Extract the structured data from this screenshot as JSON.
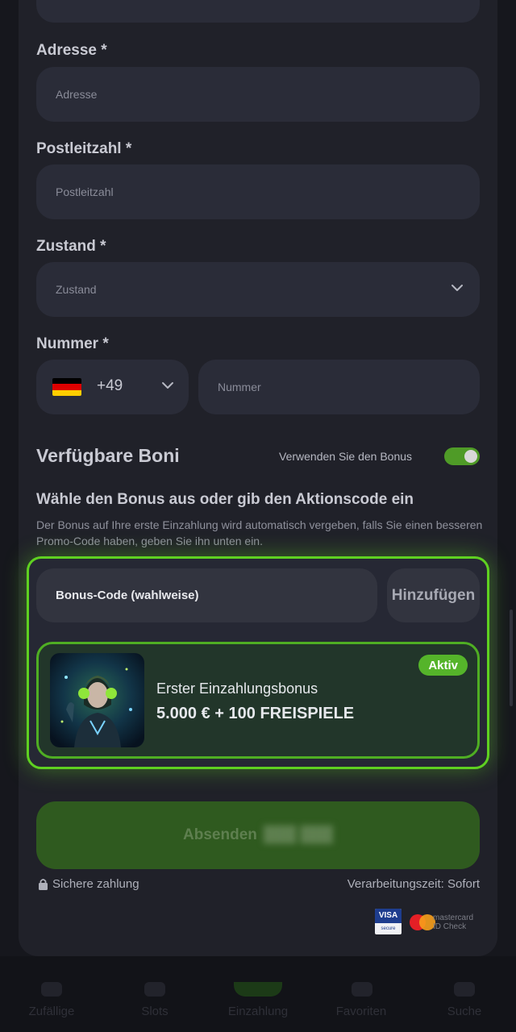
{
  "form": {
    "address": {
      "label": "Adresse *",
      "placeholder": "Adresse"
    },
    "postcode": {
      "label": "Postleitzahl *",
      "placeholder": "Postleitzahl"
    },
    "state": {
      "label": "Zustand *",
      "placeholder": "Zustand"
    },
    "phone": {
      "label": "Nummer *",
      "country_code": "+49",
      "placeholder": "Nummer"
    }
  },
  "bonus": {
    "section_title": "Verfügbare Boni",
    "toggle_label": "Verwenden Sie den Bonus",
    "toggle_on": true,
    "subtitle": "Wähle den Bonus aus oder gib den Aktionscode ein",
    "description": "Der Bonus auf Ihre erste Einzahlung wird automatisch vergeben, falls Sie einen besseren Promo-Code haben, geben Sie ihn unten ein.",
    "code_placeholder": "Bonus-Code (wahlweise)",
    "add_label": "Hinzufügen",
    "card": {
      "badge": "Aktiv",
      "name": "Erster Einzahlungsbonus",
      "value": "5.000 € + 100 FREISPIELE"
    }
  },
  "submit": {
    "label": "Absenden"
  },
  "footer": {
    "secure": "Sichere zahlung",
    "processing": "Verarbeitungszeit: Sofort",
    "visa_top": "VISA",
    "visa_bottom": "secure",
    "mastercard": "mastercard ID Check"
  },
  "nav": {
    "items": [
      "Zufällige",
      "Slots",
      "Einzahlung",
      "Favoriten",
      "Suche"
    ]
  },
  "colors": {
    "accent": "#5fd121",
    "background": "#16171d",
    "panel": "#202129",
    "field": "#2a2c38"
  },
  "icons": [
    "chevron-down-icon",
    "lock-icon",
    "germany-flag-icon",
    "visa-logo",
    "mastercard-logo"
  ]
}
